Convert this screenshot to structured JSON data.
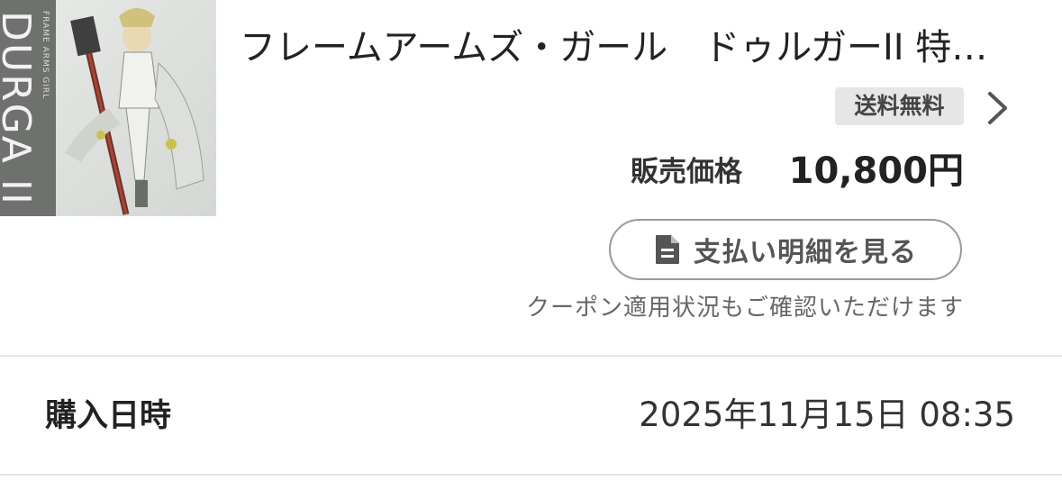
{
  "product": {
    "title": "フレームアームズ・ガール　ドゥルガーII 特…",
    "thumbnail": {
      "side_text_large": "DURGA II",
      "side_text_small": "FRAME ARMS GIRL"
    },
    "shipping_badge": "送料無料",
    "price_label": "販売価格",
    "price_value": "10,800円",
    "statement_button_label": "支払い明細を見る",
    "coupon_note": "クーポン適用状況もご確認いただけます"
  },
  "purchase": {
    "label": "購入日時",
    "value": "2025年11月15日 08:35"
  },
  "icons": {
    "chevron": "chevron-right-icon",
    "statement": "document-icon"
  },
  "colors": {
    "badge_bg": "#e6e6e6",
    "button_border": "#9a9a9a",
    "muted_text": "#666666"
  }
}
